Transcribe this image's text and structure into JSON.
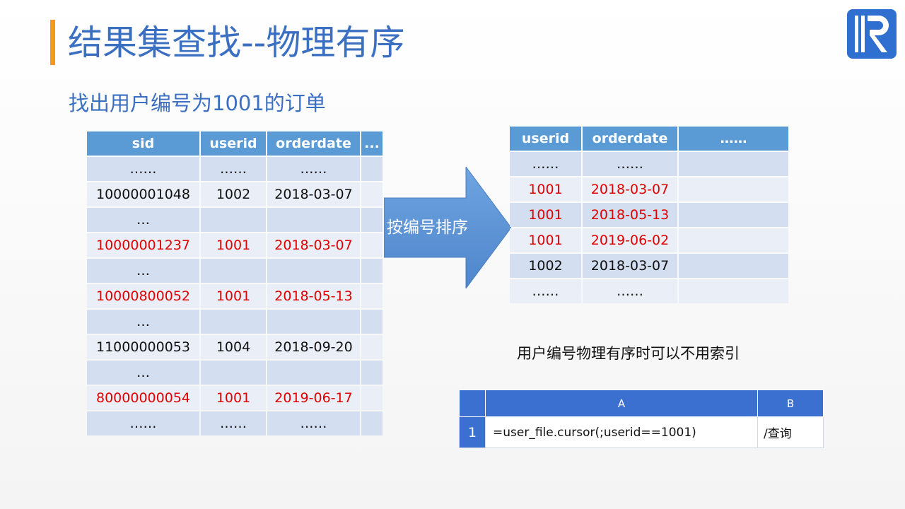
{
  "title": "结果集查找--物理有序",
  "subtitle": "找出用户编号为1001的订单",
  "left_table": {
    "headers": [
      "sid",
      "userid",
      "orderdate",
      "..."
    ],
    "rows": [
      [
        "……",
        "……",
        "……",
        ""
      ],
      [
        "10000001048",
        "1002",
        "2018-03-07",
        ""
      ],
      [
        "…",
        "",
        "",
        ""
      ],
      [
        "10000001237",
        "1001",
        "2018-03-07",
        ""
      ],
      [
        "…",
        "",
        "",
        ""
      ],
      [
        "10000800052",
        "1001",
        "2018-05-13",
        ""
      ],
      [
        "…",
        "",
        "",
        ""
      ],
      [
        "11000000053",
        "1004",
        "2018-09-20",
        ""
      ],
      [
        "…",
        "",
        "",
        ""
      ],
      [
        "80000000054",
        "1001",
        "2019-06-17",
        ""
      ],
      [
        "……",
        "……",
        "……",
        ""
      ]
    ],
    "highlighted_rows": [
      3,
      5,
      9
    ]
  },
  "arrow_label": "按编号排序",
  "right_table": {
    "headers": [
      "userid",
      "orderdate",
      "……"
    ],
    "rows": [
      [
        "……",
        "……",
        ""
      ],
      [
        "1001",
        "2018-03-07",
        ""
      ],
      [
        "1001",
        "2018-05-13",
        ""
      ],
      [
        "1001",
        "2019-06-02",
        ""
      ],
      [
        "1002",
        "2018-03-07",
        ""
      ],
      [
        "……",
        "……",
        ""
      ]
    ],
    "highlighted_rows": [
      1,
      2,
      3
    ]
  },
  "note": "用户编号物理有序时可以不用索引",
  "code_table": {
    "col_a": "A",
    "col_b": "B",
    "row_num": "1",
    "cell_a1": "=user_file.cursor(;userid==1001)",
    "cell_b1": "/查询"
  },
  "colors": {
    "accent": "#3b6fc2",
    "title_bar": "#f39a1e",
    "header_blue": "#5b9bd5",
    "highlight_red": "#e00000"
  }
}
